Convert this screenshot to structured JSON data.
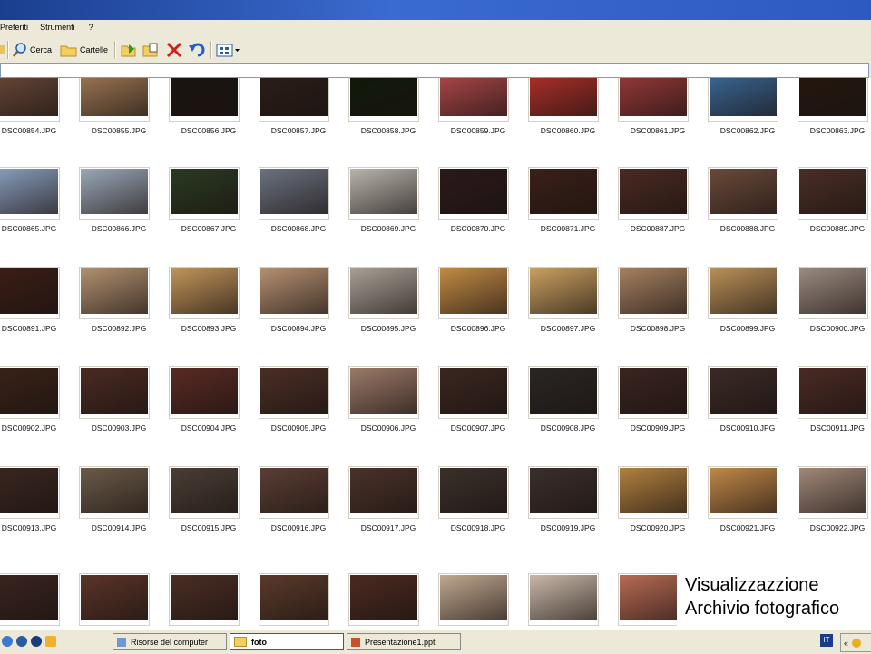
{
  "menu": [
    "Preferiti",
    "Strumenti",
    "?"
  ],
  "toolbar": {
    "search_label": "Cerca",
    "folders_label": "Cartelle"
  },
  "files": [
    [
      "DSC00854.JPG",
      "DSC00855.JPG",
      "DSC00856.JPG",
      "DSC00857.JPG",
      "DSC00858.JPG",
      "DSC00859.JPG",
      "DSC00860.JPG",
      "DSC00861.JPG",
      "DSC00862.JPG",
      "DSC00863.JPG"
    ],
    [
      "DSC00865.JPG",
      "DSC00866.JPG",
      "DSC00867.JPG",
      "DSC00868.JPG",
      "DSC00869.JPG",
      "DSC00870.JPG",
      "DSC00871.JPG",
      "DSC00887.JPG",
      "DSC00888.JPG",
      "DSC00889.JPG"
    ],
    [
      "DSC00891.JPG",
      "DSC00892.JPG",
      "DSC00893.JPG",
      "DSC00894.JPG",
      "DSC00895.JPG",
      "DSC00896.JPG",
      "DSC00897.JPG",
      "DSC00898.JPG",
      "DSC00899.JPG",
      "DSC00900.JPG"
    ],
    [
      "DSC00902.JPG",
      "DSC00903.JPG",
      "DSC00904.JPG",
      "DSC00905.JPG",
      "DSC00906.JPG",
      "DSC00907.JPG",
      "DSC00908.JPG",
      "DSC00909.JPG",
      "DSC00910.JPG",
      "DSC00911.JPG"
    ],
    [
      "DSC00913.JPG",
      "DSC00914.JPG",
      "DSC00915.JPG",
      "DSC00916.JPG",
      "DSC00917.JPG",
      "DSC00918.JPG",
      "DSC00919.JPG",
      "DSC00920.JPG",
      "DSC00921.JPG",
      "DSC00922.JPG"
    ],
    [
      "",
      "",
      "",
      "",
      "",
      "",
      "",
      "",
      "",
      ""
    ]
  ],
  "thumb_colors": [
    [
      "#6a4a3a",
      "#a07a55",
      "#1a1410",
      "#2a1e18",
      "#0f1a0a",
      "#b0484a",
      "#b2302a",
      "#9a3a3a",
      "#3a6a9a",
      "#24180f"
    ],
    [
      "#8aa0c0",
      "#9aa8b8",
      "#2a3a22",
      "#6a7280",
      "#b8b4ac",
      "#2a1a1a",
      "#3a2018",
      "#4a2a22",
      "#6a4a3a",
      "#4a2e26"
    ],
    [
      "#3a1e16",
      "#b09070",
      "#c0945a",
      "#b49070",
      "#a8a096",
      "#c08a44",
      "#c8a060",
      "#a48060",
      "#b89058",
      "#9a8a80"
    ],
    [
      "#3a2218",
      "#4a2a22",
      "#5a2a24",
      "#4a2e26",
      "#9a7a68",
      "#3a2620",
      "#2a2624",
      "#3a2420",
      "#3a2a26",
      "#4a2a24"
    ],
    [
      "#3a2620",
      "#6a5a48",
      "#4a3e36",
      "#5a3e34",
      "#4a322a",
      "#3a302a",
      "#3a2e2a",
      "#b08040",
      "#c08848",
      "#a08878"
    ],
    [
      "#3a2420",
      "#5a3428",
      "#4a2e24",
      "#5a3a2a",
      "#4a2a20",
      "#c0a890",
      "#c8b8a8",
      "#b86a54",
      "",
      ""
    ]
  ],
  "overlay": {
    "line1": "Visualizzazzione",
    "line2": "Archivio fotografico"
  },
  "taskbar": {
    "btn1": "Risorse del computer",
    "btn2": "foto",
    "btn3": "Presentazione1.ppt",
    "lang": "IT"
  }
}
